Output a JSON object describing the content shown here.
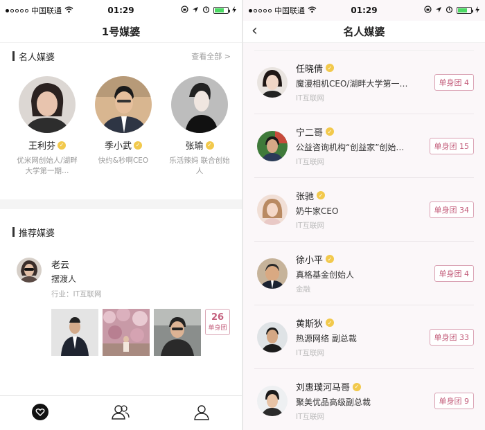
{
  "colors": {
    "accent": "#c4607d",
    "verified_badge": "#f2c94c",
    "battery": "#4cd964"
  },
  "left": {
    "status": {
      "carrier": "中国联通",
      "time": "01:29"
    },
    "nav_title": "1号媒婆",
    "celebrity_section": {
      "title": "名人媒婆",
      "more": "查看全部 >",
      "items": [
        {
          "name": "王利芬",
          "desc": "优米网创始人/湖畔大学第一期…"
        },
        {
          "name": "季小武",
          "desc": "快约&秒啊CEO"
        },
        {
          "name": "张瑜",
          "desc": "乐活辣妈 联合创始人"
        }
      ]
    },
    "recommend_section": {
      "title": "推荐媒婆",
      "item": {
        "name": "老云",
        "subtitle": "摆渡人",
        "industry": "行业：IT互联网",
        "team_count": "26",
        "team_label": "单身团"
      }
    },
    "tabs": [
      {
        "icon": "heart-icon"
      },
      {
        "icon": "people-icon"
      },
      {
        "icon": "person-icon"
      }
    ]
  },
  "right": {
    "status": {
      "carrier": "中国联通",
      "time": "01:29"
    },
    "nav_title": "名人媒婆",
    "items": [
      {
        "name": "任晓倩",
        "title": "魔漫相机CEO/湖畔大学第一…",
        "company": "IT互联网",
        "team": "单身团 4"
      },
      {
        "name": "宁二哥",
        "title": "公益咨询机构“创益家”创始…",
        "company": "IT互联网",
        "team": "单身团 15"
      },
      {
        "name": "张驰",
        "title": "奶牛家CEO",
        "company": "IT互联网",
        "team": "单身团 34"
      },
      {
        "name": "徐小平",
        "title": "真格基金创始人",
        "company": "金融",
        "team": "单身团 4"
      },
      {
        "name": "黄斯狄",
        "title": "热源网络 副总裁",
        "company": "IT互联网",
        "team": "单身团 33"
      },
      {
        "name": "刘惠璞河马哥",
        "title": "聚美优品高级副总裁",
        "company": "IT互联网",
        "team": "单身团 9"
      }
    ]
  }
}
